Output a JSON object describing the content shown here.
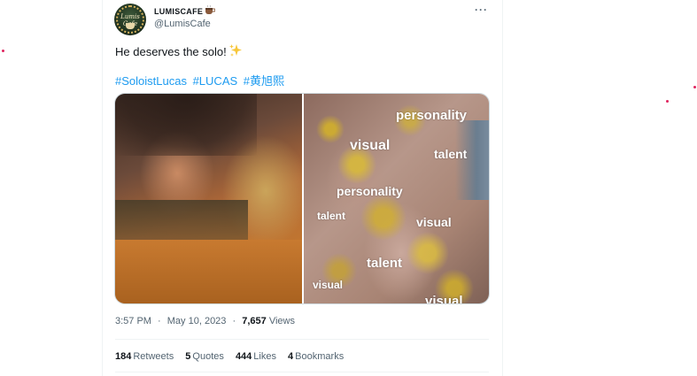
{
  "author": {
    "name": "LUMISCAFE",
    "name_emoji": "coffee-cup-emoji",
    "handle": "@LumisCafe",
    "avatar_icon": "lumis-cafe-logo",
    "avatar_logo_text": "Lumis Cafe"
  },
  "more_icon": "more-options-icon",
  "tweet": {
    "text": "He deserves the solo!",
    "text_emoji": "sparkles-emoji",
    "hashtags": [
      "#SoloistLucas",
      "#LUCAS",
      "#黄旭熙"
    ]
  },
  "media": {
    "left_image": "photo-of-person-in-orange-sweater",
    "right_image": "hand-covered-in-gold-glitter",
    "overlay_words": [
      "personality",
      "visual",
      "talent",
      "personality",
      "talent",
      "visual",
      "talent",
      "visual",
      "visual"
    ]
  },
  "meta": {
    "time": "3:57 PM",
    "separator": "·",
    "date": "May 10, 2023",
    "views_count": "7,657",
    "views_label": "Views"
  },
  "stats": {
    "retweets_count": "184",
    "retweets_label": "Retweets",
    "quotes_count": "5",
    "quotes_label": "Quotes",
    "likes_count": "444",
    "likes_label": "Likes",
    "bookmarks_count": "4",
    "bookmarks_label": "Bookmarks"
  },
  "colors": {
    "link": "#1d9bf0",
    "text": "#0f1419",
    "secondary": "#536471",
    "border": "#eff3f4"
  }
}
